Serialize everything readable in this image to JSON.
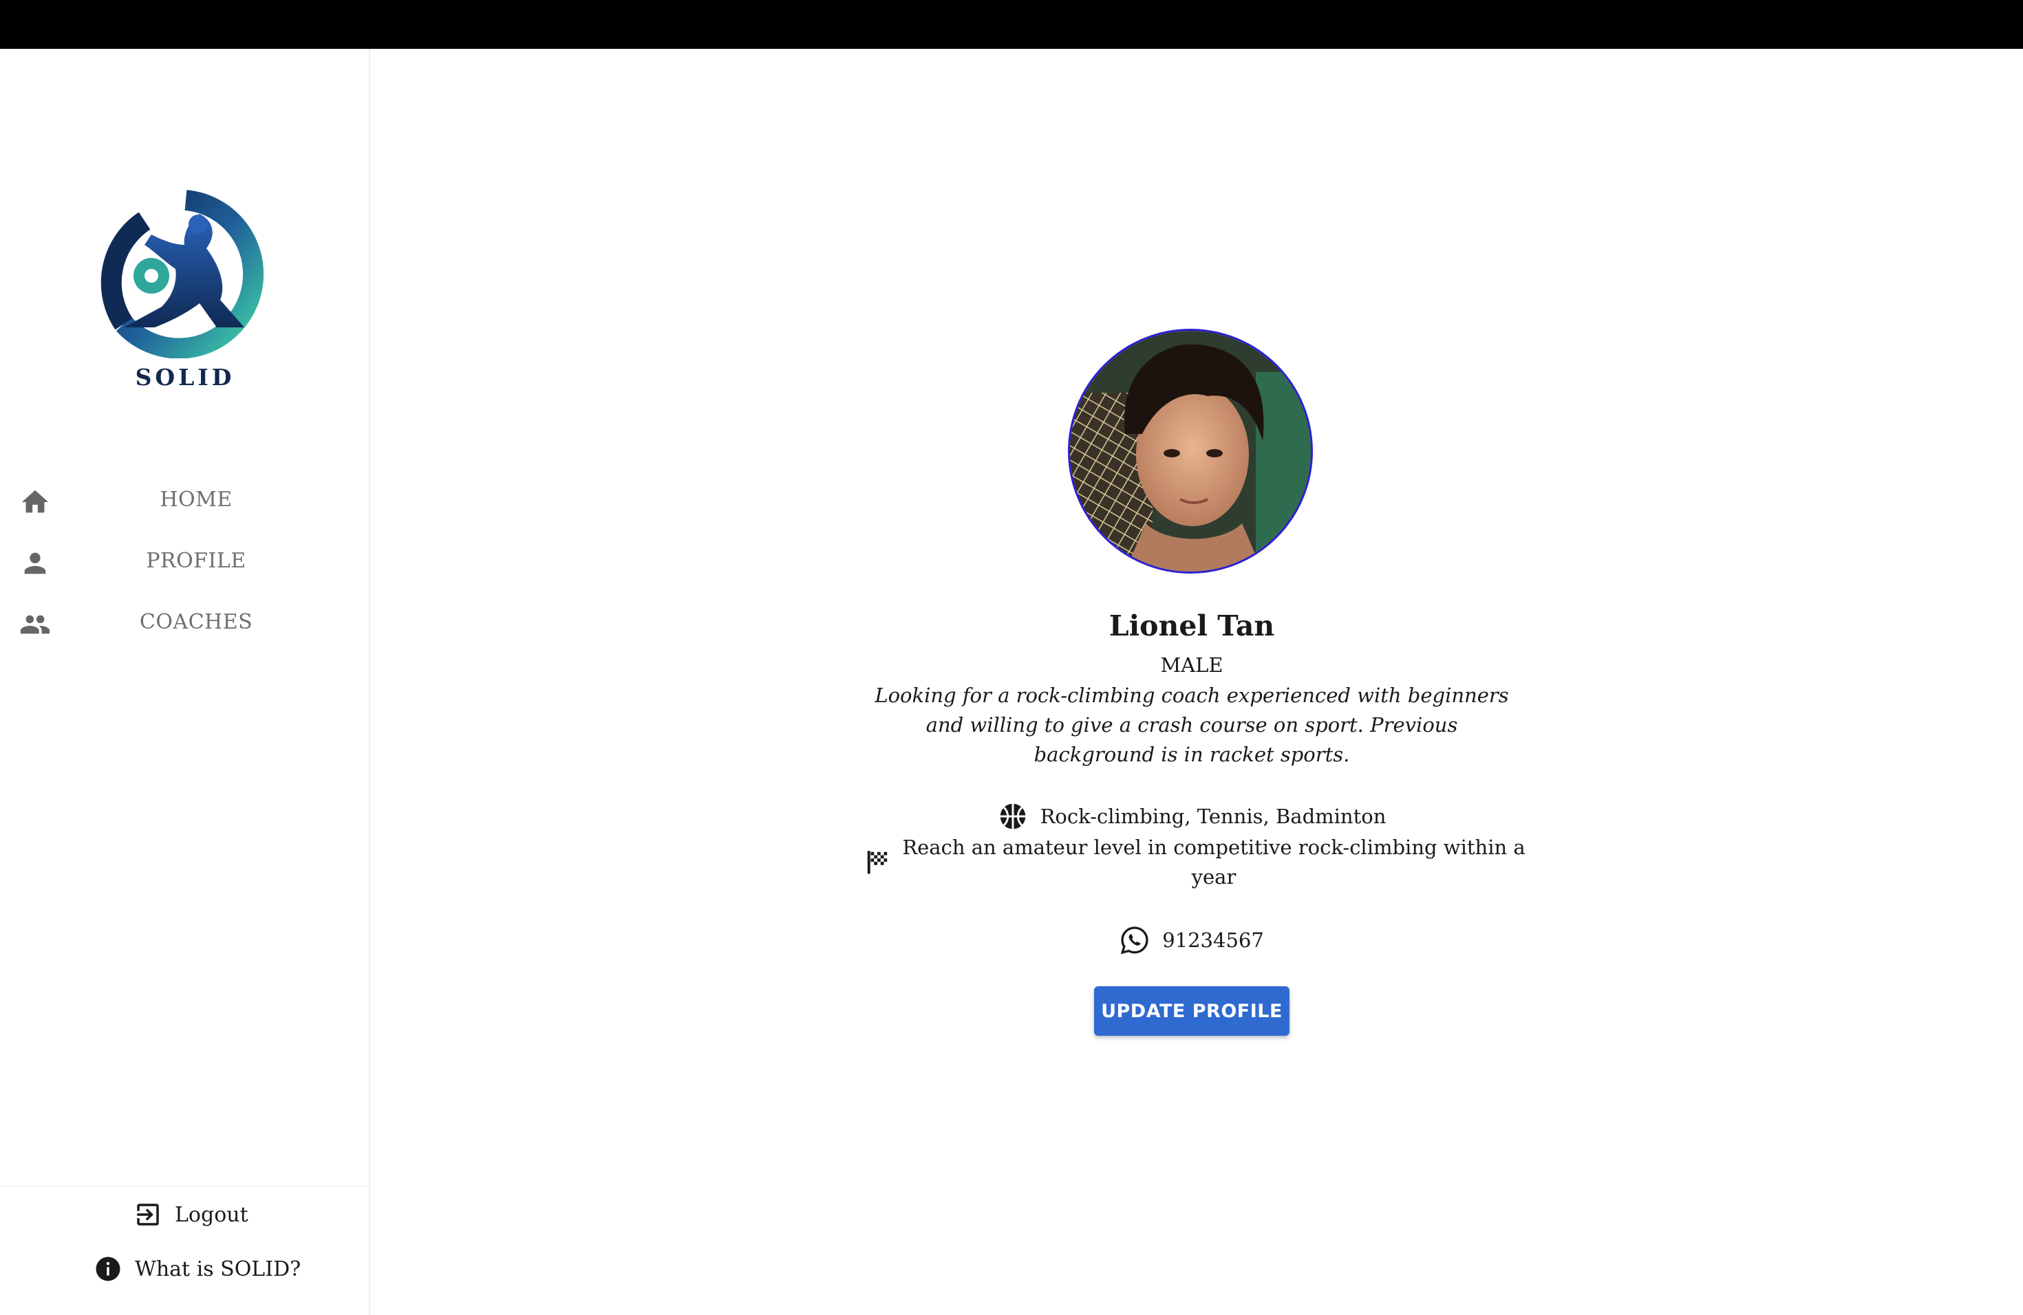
{
  "brand": {
    "name": "SOLID",
    "logo_icon": "solid-athlete-logo"
  },
  "nav": [
    {
      "label": "HOME",
      "icon": "home-icon"
    },
    {
      "label": "PROFILE",
      "icon": "person-icon"
    },
    {
      "label": "COACHES",
      "icon": "group-icon"
    }
  ],
  "footer": {
    "logout_label": "Logout",
    "about_label": "What is SOLID?"
  },
  "profile": {
    "name": "Lionel Tan",
    "gender": "MALE",
    "bio": "Looking for a rock-climbing coach experienced with beginners and willing to give a crash course on sport. Previous background is in racket sports.",
    "sports": "Rock-climbing, Tennis, Badminton",
    "goal": "Reach an amateur level in competitive rock-climbing within a year",
    "phone": "91234567",
    "update_button": "UPDATE PROFILE"
  },
  "colors": {
    "accent": "#2f6ad0",
    "brand_text": "#13284f",
    "nav_text": "#6f6f6f",
    "avatar_border": "#2b1fd0",
    "top_bar": "#000000"
  }
}
